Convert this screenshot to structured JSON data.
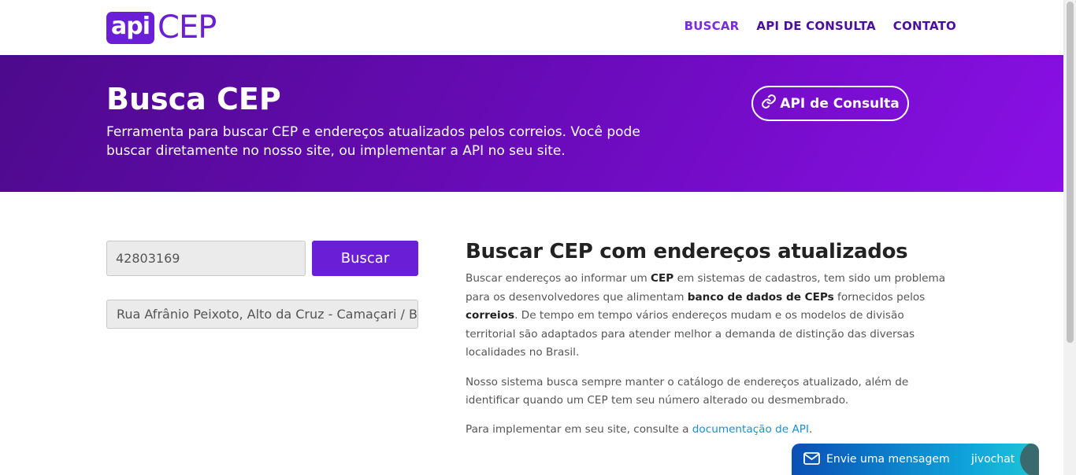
{
  "logo": {
    "api": "api",
    "cep": "CEP"
  },
  "nav": {
    "items": [
      {
        "label": "BUSCAR"
      },
      {
        "label": "API DE CONSULTA"
      },
      {
        "label": "CONTATO"
      }
    ]
  },
  "hero": {
    "title": "Busca CEP",
    "description": "Ferramenta para buscar CEP e endereços atualizados pelos correios. Você pode buscar diretamente no nosso site, ou implementar a API no seu site.",
    "button_label": "API de Consulta",
    "button_icon": "link-icon"
  },
  "search": {
    "cep_value": "42803169",
    "button_label": "Buscar",
    "result": "Rua Afrânio Peixoto, Alto da Cruz - Camaçari / BA"
  },
  "content": {
    "title": "Buscar CEP com endereços atualizados",
    "p1": {
      "t1": "Buscar endereços ao informar um ",
      "b1": "CEP",
      "t2": " em sistemas de cadastros, tem sido um problema para os desenvolvedores que alimentam ",
      "b2": "banco de dados de CEPs",
      "t3": " fornecidos pelos ",
      "b3": "correios",
      "t4": ". De tempo em tempo vários endereços mudam e os modelos de divisão territorial são adaptados para atender melhor a demanda de distinção das diversas localidades no Brasil."
    },
    "p2": "Nosso sistema busca sempre manter o catálogo de endereços atualizado, além de identificar quando um CEP tem seu número alterado ou desmembrado.",
    "p3": {
      "text": "Para implementar em seu site, consulte a ",
      "link": "documentação de API",
      "end": "."
    }
  },
  "chat": {
    "label": "Envie uma mensagem",
    "brand": "jivochat",
    "icon": "envelope-icon"
  },
  "colors": {
    "brand": "#6a1fd6",
    "hero_start": "#4d0a8c",
    "hero_end": "#8a10e6",
    "link": "#1b8fd0"
  }
}
